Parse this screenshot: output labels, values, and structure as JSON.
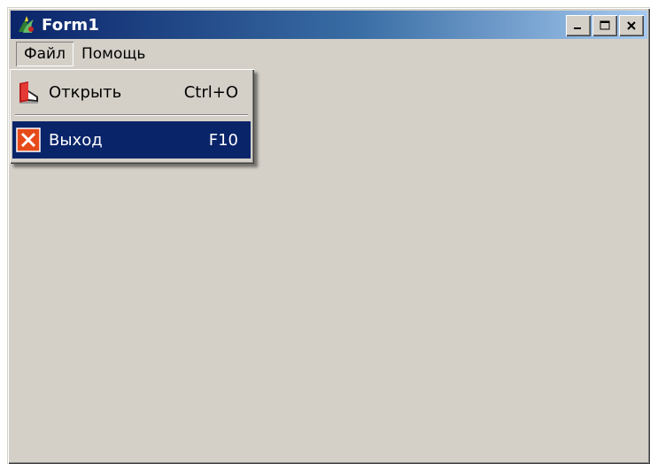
{
  "window": {
    "title": "Form1",
    "icon": "delphi-app-icon",
    "controls": [
      "minimize-icon",
      "maximize-icon",
      "close-icon"
    ]
  },
  "menubar": {
    "items": [
      {
        "label": "Файл",
        "state": "open"
      },
      {
        "label": "Помощь"
      }
    ]
  },
  "dropdown": {
    "items": [
      {
        "label": "Открыть",
        "shortcut": "Ctrl+O",
        "icon": "open-book-icon",
        "highlighted": false
      },
      {
        "label": "Выход",
        "shortcut": "F10",
        "icon": "exit-x-icon",
        "highlighted": true
      }
    ]
  },
  "colors": {
    "face": "#d4d0c8",
    "titlebar_start": "#0a246a",
    "titlebar_end": "#a6caf0",
    "highlight": "#0a246a"
  }
}
